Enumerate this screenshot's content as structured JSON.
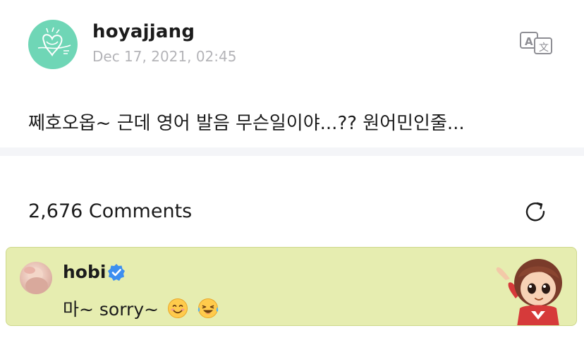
{
  "post": {
    "username": "hoyajjang",
    "timestamp": "Dec 17, 2021, 02:45",
    "body": "쩨호오옵~ 근데 영어 발음 무슨일이야...?? 원어민인줄..."
  },
  "comments": {
    "count_label": "2,676 Comments"
  },
  "top_comment": {
    "author": "hobi",
    "text": "마~ sorry~"
  },
  "icons": {
    "translate": "translate-icon",
    "refresh": "refresh-icon",
    "verified": "verified-badge-icon",
    "emoji_1": "smiling-face-emoji",
    "emoji_2": "tears-of-joy-emoji"
  },
  "colors": {
    "avatar_bg": "#6fd6b6",
    "highlight_bg": "#e6edb0",
    "verified_blue": "#3d8ff0",
    "timestamp_gray": "#b4b4b8"
  }
}
